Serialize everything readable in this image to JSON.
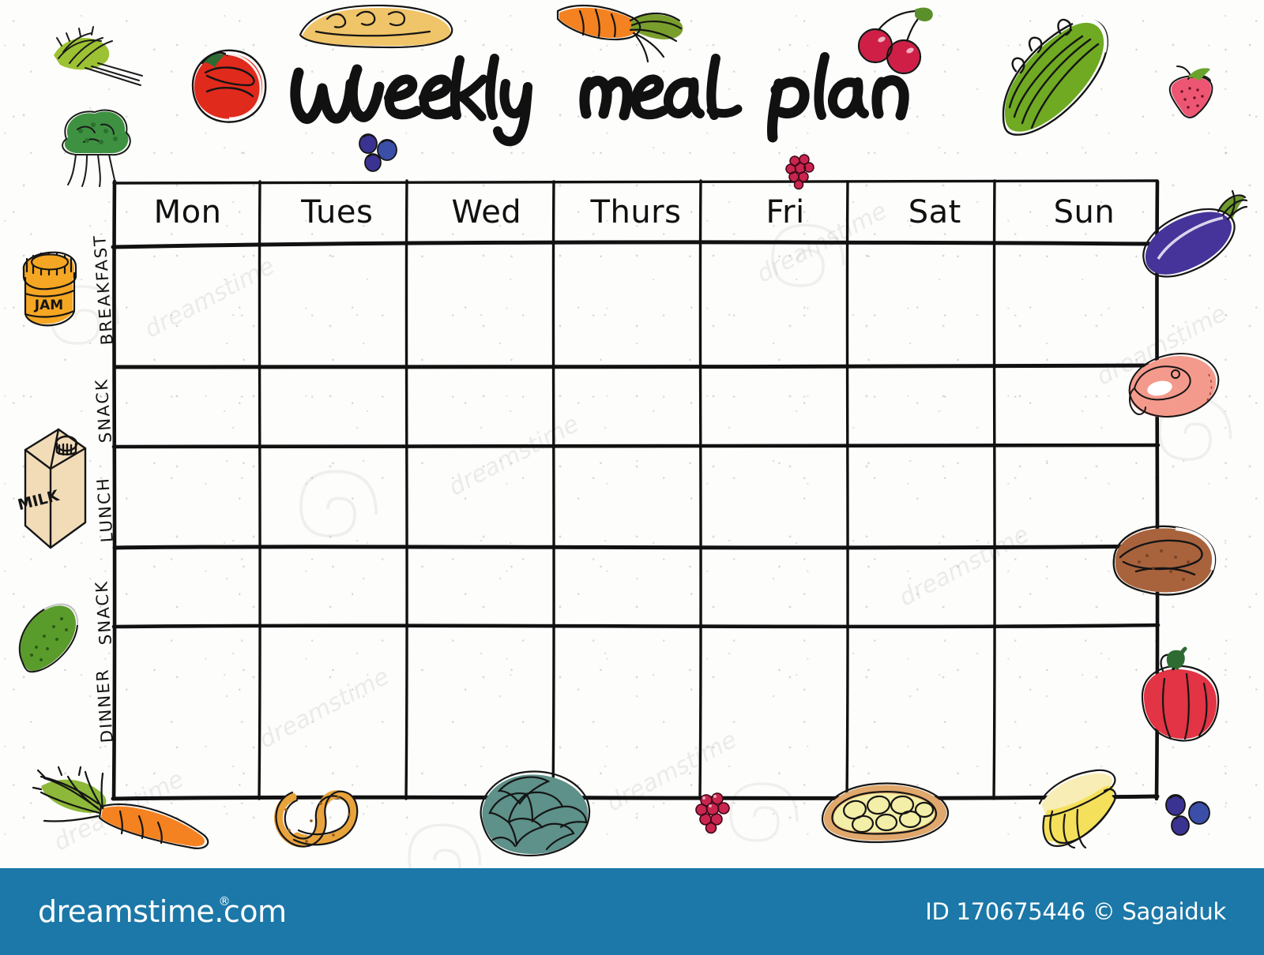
{
  "document": {
    "title": "Weekly meal plan",
    "title_words": [
      "Weekly",
      "meal",
      "plan"
    ]
  },
  "planner": {
    "day_headers": [
      "Mon",
      "Tues",
      "Wed",
      "Thurs",
      "Fri",
      "Sat",
      "Sun"
    ],
    "meal_rows": [
      "BREAKFAST",
      "SNACK",
      "LUNCH",
      "SNACK",
      "DINNER"
    ],
    "cells": [
      [
        "",
        "",
        "",
        "",
        "",
        "",
        ""
      ],
      [
        "",
        "",
        "",
        "",
        "",
        "",
        ""
      ],
      [
        "",
        "",
        "",
        "",
        "",
        "",
        ""
      ],
      [
        "",
        "",
        "",
        "",
        "",
        "",
        ""
      ],
      [
        "",
        "",
        "",
        "",
        "",
        "",
        ""
      ]
    ]
  },
  "illustrations": [
    {
      "name": "parsley-herbs-illustration",
      "color": "#8fbc2e"
    },
    {
      "name": "broccoli-illustration",
      "color": "#3f9142"
    },
    {
      "name": "tomato-illustration",
      "color": "#e02a1c"
    },
    {
      "name": "baguette-bread-illustration",
      "color": "#f0c468"
    },
    {
      "name": "carrot-illustration",
      "color": "#f58220"
    },
    {
      "name": "cherries-illustration",
      "color": "#cf1f47"
    },
    {
      "name": "celery-illustration",
      "color": "#6faa22"
    },
    {
      "name": "strawberry-illustration",
      "color": "#ed5672"
    },
    {
      "name": "blueberries-illustration",
      "color": "#3b3391"
    },
    {
      "name": "raspberry-illustration",
      "color": "#c9254f"
    },
    {
      "name": "eggplant-illustration",
      "color": "#46349a"
    },
    {
      "name": "ham-slice-illustration",
      "color": "#f49a8c"
    },
    {
      "name": "rye-bread-illustration",
      "color": "#a8633d"
    },
    {
      "name": "red-bell-pepper-illustration",
      "color": "#e23444"
    },
    {
      "name": "jam-jar-illustration",
      "color": "#f5a623",
      "label": "JAM"
    },
    {
      "name": "milk-carton-illustration",
      "color": "#f2dcb8",
      "label": "MILK"
    },
    {
      "name": "cucumber-illustration",
      "color": "#5a9c2c"
    },
    {
      "name": "carrot-bottom-illustration",
      "color": "#f58220"
    },
    {
      "name": "pretzel-illustration",
      "color": "#e8a33d"
    },
    {
      "name": "lettuce-cabbage-illustration",
      "color": "#5d9189"
    },
    {
      "name": "corn-cob-illustration",
      "color": "#f4efa8"
    },
    {
      "name": "banana-illustration",
      "color": "#f4e05a"
    },
    {
      "name": "blueberries-bottom-illustration",
      "color": "#3b3391"
    }
  ],
  "watermark": {
    "text": "dreamstime",
    "repeat_count": 8
  },
  "footer": {
    "brand": "dreamstime.com",
    "registered_mark": "®",
    "credit": "ID 170675446 © Sagaiduk",
    "background_color": "#1b78a8"
  }
}
